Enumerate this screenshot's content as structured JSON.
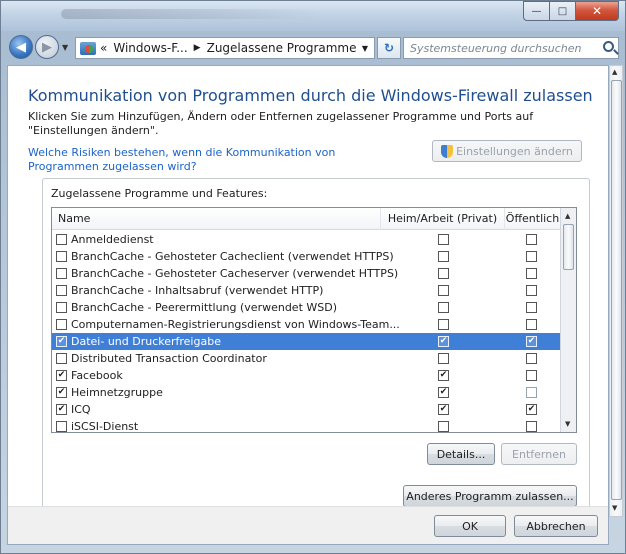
{
  "window": {
    "minimize_glyph": "—",
    "maximize_glyph": "□",
    "close_glyph": "✕"
  },
  "nav": {
    "back_glyph": "◀",
    "forward_glyph": "▶",
    "breadcrumb_prefix": "«",
    "breadcrumb": [
      "Windows-F...",
      "Zugelassene Programme"
    ],
    "breadcrumb_sep": "▶",
    "refresh_glyph": "↻",
    "search_placeholder": "Systemsteuerung durchsuchen"
  },
  "page": {
    "title": "Kommunikation von Programmen durch die Windows-Firewall zulassen",
    "description": "Klicken Sie zum Hinzufügen, Ändern oder Entfernen zugelassener Programme und Ports auf \"Einstellungen ändern\".",
    "risk_link": "Welche Risiken bestehen, wenn die Kommunikation von Programmen zugelassen wird?",
    "change_settings_label": "Einstellungen ändern"
  },
  "group": {
    "label": "Zugelassene Programme und Features:",
    "columns": {
      "name": "Name",
      "home": "Heim/Arbeit (Privat)",
      "public": "Öffentlich"
    },
    "rows": [
      {
        "name": "Anmeldedienst",
        "enabled": false,
        "home": false,
        "public": false
      },
      {
        "name": "BranchCache - Gehosteter Cacheclient (verwendet HTTPS)",
        "enabled": false,
        "home": false,
        "public": false
      },
      {
        "name": "BranchCache - Gehosteter Cacheserver (verwendet HTTPS)",
        "enabled": false,
        "home": false,
        "public": false
      },
      {
        "name": "BranchCache - Inhaltsabruf (verwendet HTTP)",
        "enabled": false,
        "home": false,
        "public": false
      },
      {
        "name": "BranchCache - Peerermittlung (verwendet WSD)",
        "enabled": false,
        "home": false,
        "public": false
      },
      {
        "name": "Computernamen-Registrierungsdienst von Windows-Team...",
        "enabled": false,
        "home": false,
        "public": false
      },
      {
        "name": "Datei- und Druckerfreigabe",
        "enabled": true,
        "home": true,
        "public": true,
        "selected": true
      },
      {
        "name": "Distributed Transaction Coordinator",
        "enabled": false,
        "home": false,
        "public": false
      },
      {
        "name": "Facebook",
        "enabled": true,
        "home": true,
        "public": false
      },
      {
        "name": "Heimnetzgruppe",
        "enabled": true,
        "home": true,
        "public": false
      },
      {
        "name": "ICQ",
        "enabled": true,
        "home": true,
        "public": true
      },
      {
        "name": "iSCSI-Dienst",
        "enabled": false,
        "home": false,
        "public": false
      }
    ],
    "details_label": "Details...",
    "remove_label": "Entfernen",
    "add_program_label": "Anderes Programm zulassen..."
  },
  "footer": {
    "ok_label": "OK",
    "cancel_label": "Abbrechen"
  }
}
